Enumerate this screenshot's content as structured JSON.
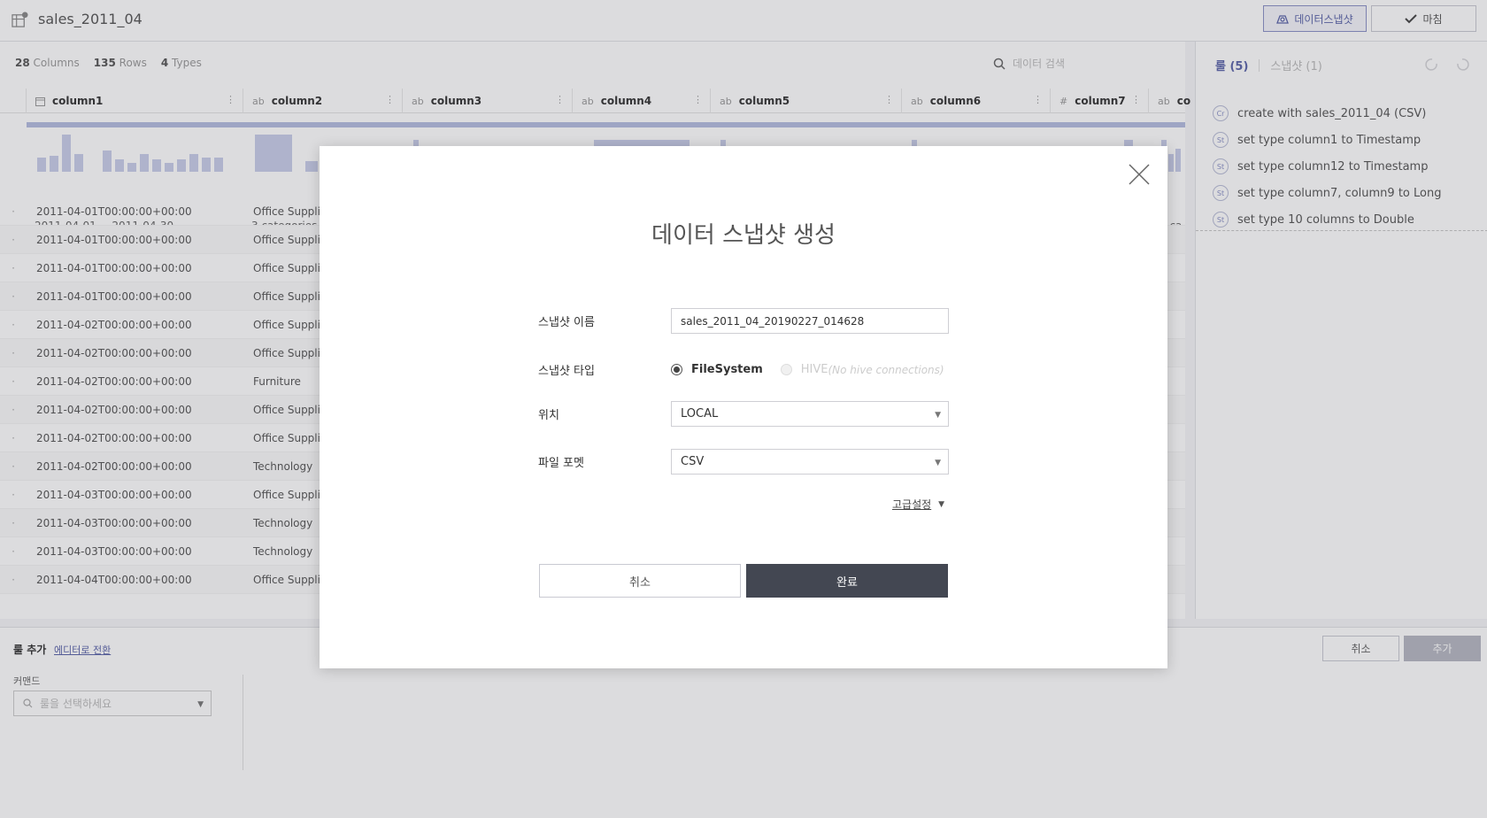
{
  "window": {
    "title": "sales_2011_04"
  },
  "toolbar": {
    "snapshot_label": "데이터스냅샷",
    "finish_label": "마침"
  },
  "stats": {
    "columns_count": "28",
    "columns_label": "Columns",
    "rows_count": "135",
    "rows_label": "Rows",
    "types_count": "4",
    "types_label": "Types"
  },
  "search": {
    "placeholder": "데이터 검색"
  },
  "columns": [
    {
      "type": "date-icon",
      "name": "column1"
    },
    {
      "type": "ab",
      "name": "column2"
    },
    {
      "type": "ab",
      "name": "column3"
    },
    {
      "type": "ab",
      "name": "column4"
    },
    {
      "type": "ab",
      "name": "column5"
    },
    {
      "type": "ab",
      "name": "column6"
    },
    {
      "type": "#",
      "name": "column7"
    },
    {
      "type": "ab",
      "name": "co"
    }
  ],
  "histogram_labels": {
    "col1": "2011-04-01 ~ 2011-04-30",
    "col2": "3 categories",
    "col8": "9 ca"
  },
  "rows": [
    {
      "c1": "2011-04-01T00:00:00+00:00",
      "c2": "Office Suppli"
    },
    {
      "c1": "2011-04-01T00:00:00+00:00",
      "c2": "Office Suppli"
    },
    {
      "c1": "2011-04-01T00:00:00+00:00",
      "c2": "Office Suppli"
    },
    {
      "c1": "2011-04-01T00:00:00+00:00",
      "c2": "Office Suppli"
    },
    {
      "c1": "2011-04-02T00:00:00+00:00",
      "c2": "Office Suppli"
    },
    {
      "c1": "2011-04-02T00:00:00+00:00",
      "c2": "Office Suppli"
    },
    {
      "c1": "2011-04-02T00:00:00+00:00",
      "c2": "Furniture"
    },
    {
      "c1": "2011-04-02T00:00:00+00:00",
      "c2": "Office Suppli"
    },
    {
      "c1": "2011-04-02T00:00:00+00:00",
      "c2": "Office Suppli"
    },
    {
      "c1": "2011-04-02T00:00:00+00:00",
      "c2": "Technology"
    },
    {
      "c1": "2011-04-03T00:00:00+00:00",
      "c2": "Office Suppli"
    },
    {
      "c1": "2011-04-03T00:00:00+00:00",
      "c2": "Technology"
    },
    {
      "c1": "2011-04-03T00:00:00+00:00",
      "c2": "Technology"
    },
    {
      "c1": "2011-04-04T00:00:00+00:00",
      "c2": "Office Suppli"
    }
  ],
  "right_panel": {
    "tab_rules": "룰 (5)",
    "tab_snapshots": "스냅샷 (1)",
    "rules": [
      {
        "badge": "Cr",
        "text": "create with sales_2011_04 (CSV)"
      },
      {
        "badge": "St",
        "text": "set type column1 to Timestamp"
      },
      {
        "badge": "St",
        "text": "set type column12 to Timestamp"
      },
      {
        "badge": "St",
        "text": "set type column7, column9 to Long"
      },
      {
        "badge": "St",
        "text": "set type 10 columns to Double"
      }
    ]
  },
  "bottom": {
    "rule_add": "룰 추가",
    "to_editor": "에디터로 전환",
    "command_label": "커맨드",
    "command_placeholder": "룰을 선택하세요",
    "cancel": "취소",
    "add": "추가"
  },
  "modal": {
    "title": "데이터 스냅샷 생성",
    "name_label": "스냅샷 이름",
    "name_value": "sales_2011_04_20190227_014628",
    "type_label": "스냅샷 타입",
    "type_filesystem": "FileSystem",
    "type_hive": "HIVE",
    "type_hive_note": "(No hive connections)",
    "location_label": "위치",
    "location_value": "LOCAL",
    "format_label": "파일 포멧",
    "format_value": "CSV",
    "advanced_label": "고급설정",
    "cancel_label": "취소",
    "done_label": "완료"
  }
}
